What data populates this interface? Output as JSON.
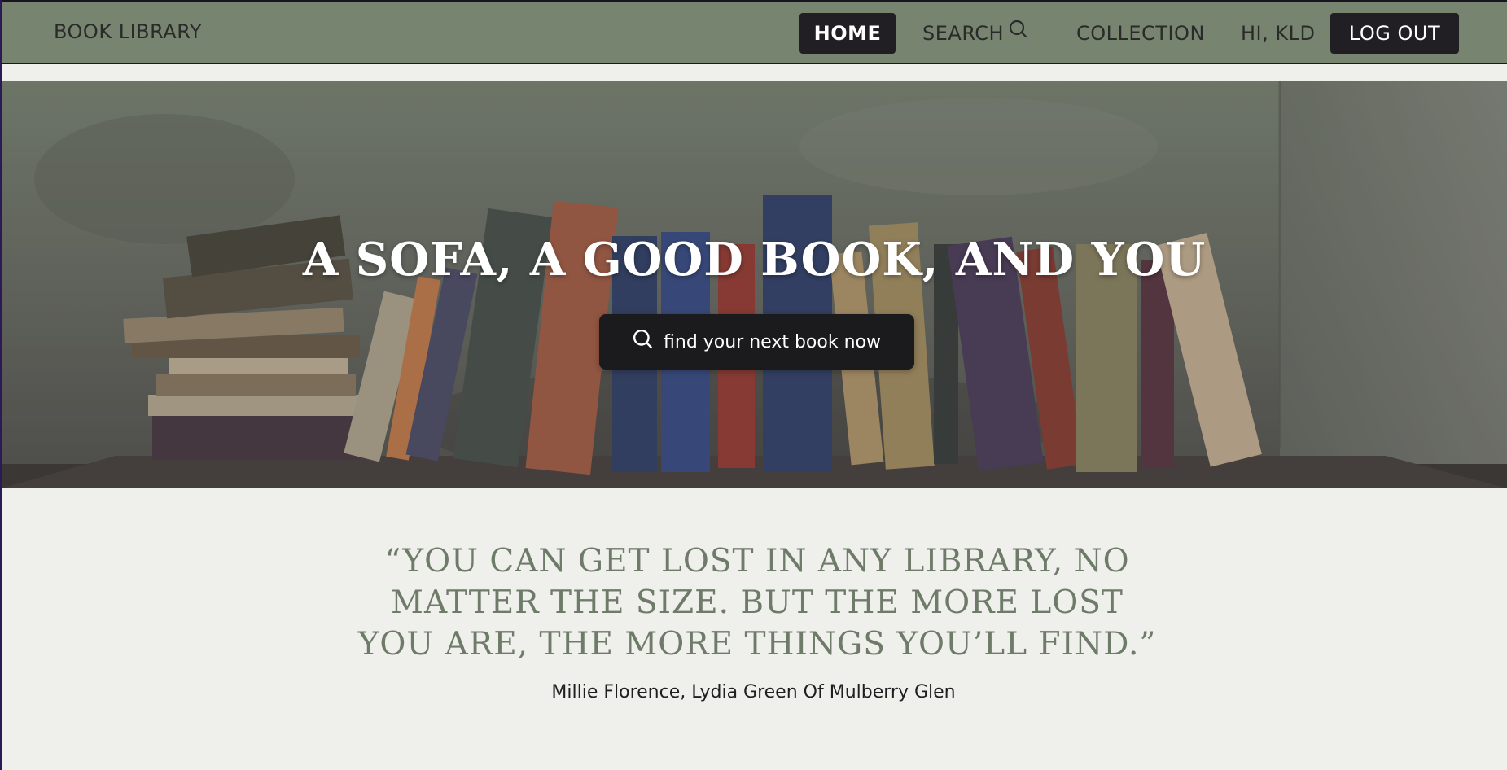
{
  "nav": {
    "brand": "BOOK LIBRARY",
    "home": "HOME",
    "search": "SEARCH",
    "collection": "COLLECTION",
    "greeting": "HI, KLD",
    "logout": "LOG OUT"
  },
  "hero": {
    "title": "A SOFA, A GOOD BOOK, AND YOU",
    "search_cta": "find your next book now"
  },
  "quote": {
    "text": "“YOU CAN GET LOST IN ANY LIBRARY, NO MATTER THE SIZE. BUT THE MORE LOST YOU ARE, THE MORE THINGS YOU’LL FIND.”",
    "attribution": "Millie Florence, Lydia Green Of Mulberry Glen"
  },
  "icons": {
    "nav_search": "search-icon",
    "hero_search": "search-icon"
  },
  "colors": {
    "nav_bg": "#778470",
    "dark_button": "#221f24",
    "quote_text": "#6e7b68",
    "page_bg": "#efefec"
  }
}
